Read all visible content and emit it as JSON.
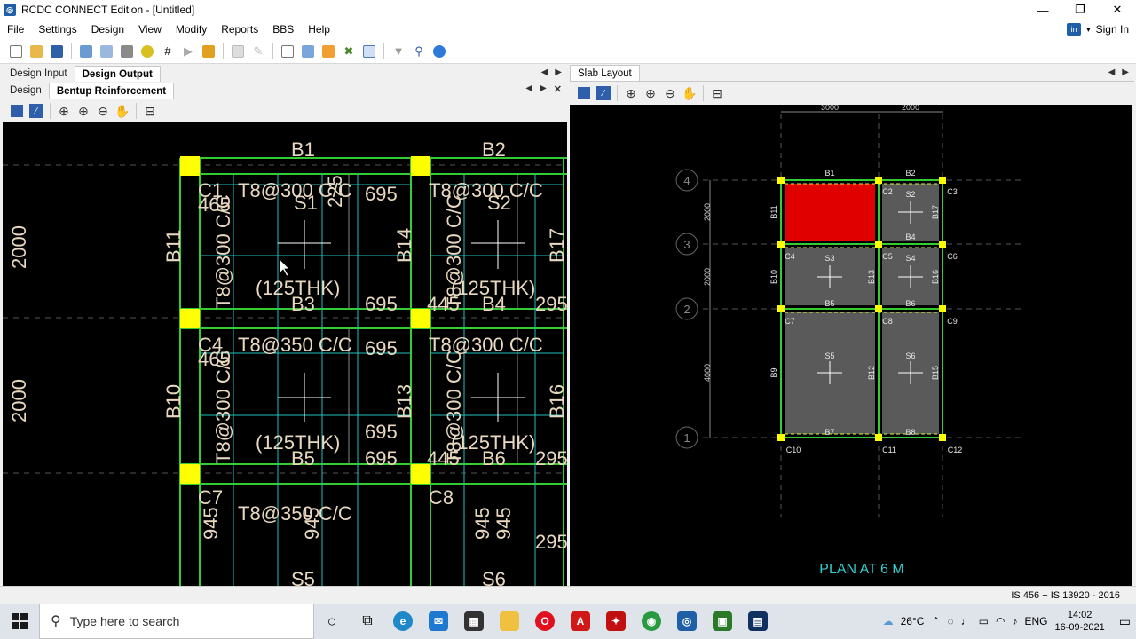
{
  "window": {
    "title": "RCDC CONNECT Edition - [Untitled]"
  },
  "menu": [
    "File",
    "Settings",
    "Design",
    "View",
    "Modify",
    "Reports",
    "BBS",
    "Help"
  ],
  "account": {
    "sign_in": "Sign In"
  },
  "left_pane": {
    "tabs": [
      "Design Input",
      "Design Output"
    ],
    "subtabs": [
      "Design",
      "Bentup Reinforcement"
    ],
    "close_glyph": "✕"
  },
  "right_pane": {
    "tabs": [
      "Slab Layout"
    ]
  },
  "reinforcement": {
    "beam_labels": {
      "b1": "B1",
      "b2": "B2",
      "b11": "B11",
      "b14": "B14",
      "b17": "B17",
      "b10": "B10",
      "b13": "B13",
      "b16": "B16",
      "b3": "B3",
      "b4": "B4",
      "b5": "B5",
      "b6": "B6"
    },
    "column_labels": {
      "c1": "C1",
      "c4": "C4",
      "c7": "C7",
      "c8": "C8"
    },
    "slab_labels": {
      "s1": "S1",
      "s2": "S2",
      "s5": "S5",
      "s6": "S6"
    },
    "dim_2000": "2000",
    "bar_spec": "T8@300 C/C",
    "bar_spec_short": "T8@350 C/C",
    "thickness": "(125THK)",
    "dims": {
      "d695": "695",
      "d465": "465",
      "d445": "445",
      "d295": "295",
      "d945": "945",
      "d225": "225"
    }
  },
  "layout": {
    "grid_top": [
      "3000",
      "2000"
    ],
    "grid_rows": [
      "4",
      "3",
      "2",
      "1"
    ],
    "row_spans": [
      "2000",
      "2000",
      "4000"
    ],
    "beams": [
      "B1",
      "B2",
      "B4",
      "B5",
      "B6",
      "B7",
      "B8",
      "B9",
      "B10",
      "B11",
      "B12",
      "B13",
      "B15",
      "B16",
      "B17"
    ],
    "columns": [
      "C2",
      "C3",
      "C4",
      "C5",
      "C6",
      "C7",
      "C8",
      "C9",
      "C10",
      "C11",
      "C12"
    ],
    "slabs": [
      "S2",
      "S3",
      "S4",
      "S5",
      "S6"
    ],
    "plan_title": "PLAN AT 6 M",
    "colors": {
      "selected": "#e00000",
      "slab": "#5a5a5a",
      "beam": "#33cc33",
      "column": "#ffff00",
      "text": "#e8d8c0",
      "plan_title": "#33cccc"
    }
  },
  "status": {
    "code": "IS 456 + IS 13920 - 2016"
  },
  "taskbar": {
    "search_placeholder": "Type here to search",
    "weather": "26°C",
    "lang": "ENG",
    "time": "14:02",
    "date": "16-09-2021"
  }
}
